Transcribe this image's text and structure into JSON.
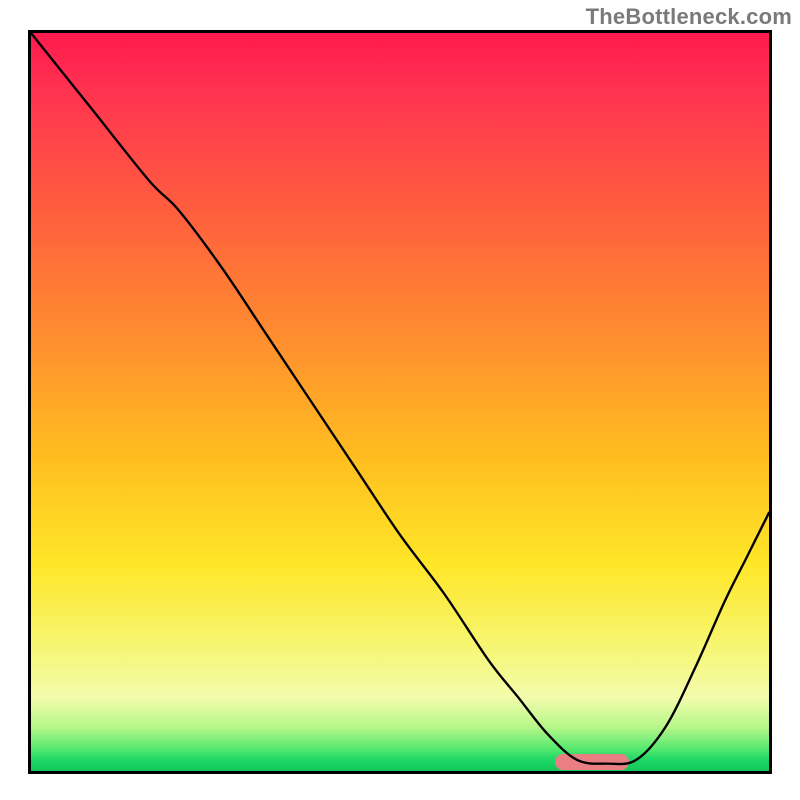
{
  "watermark": "TheBottleneck.com",
  "chart_data": {
    "type": "line",
    "title": "",
    "xlabel": "",
    "ylabel": "",
    "xlim": [
      0,
      1
    ],
    "ylim": [
      0,
      1
    ],
    "grid": false,
    "series": [
      {
        "name": "curve",
        "x": [
          0.0,
          0.08,
          0.16,
          0.2,
          0.26,
          0.32,
          0.38,
          0.44,
          0.5,
          0.56,
          0.62,
          0.66,
          0.7,
          0.74,
          0.78,
          0.82,
          0.86,
          0.9,
          0.94,
          0.97,
          1.0
        ],
        "y": [
          1.0,
          0.9,
          0.8,
          0.76,
          0.68,
          0.59,
          0.5,
          0.41,
          0.32,
          0.24,
          0.15,
          0.1,
          0.05,
          0.015,
          0.01,
          0.015,
          0.06,
          0.14,
          0.23,
          0.29,
          0.35
        ]
      }
    ],
    "marker": {
      "x_center": 0.76,
      "width": 0.1,
      "y": 0.012,
      "thickness": 0.022,
      "color": "#e97f82"
    },
    "background": {
      "type": "vertical-gradient",
      "stops": [
        {
          "pos": 0.0,
          "color": "#ff1a4d"
        },
        {
          "pos": 0.22,
          "color": "#ff5840"
        },
        {
          "pos": 0.58,
          "color": "#ffbf20"
        },
        {
          "pos": 0.82,
          "color": "#f7f56a"
        },
        {
          "pos": 0.97,
          "color": "#55e86f"
        },
        {
          "pos": 1.0,
          "color": "#12c75a"
        }
      ]
    }
  }
}
